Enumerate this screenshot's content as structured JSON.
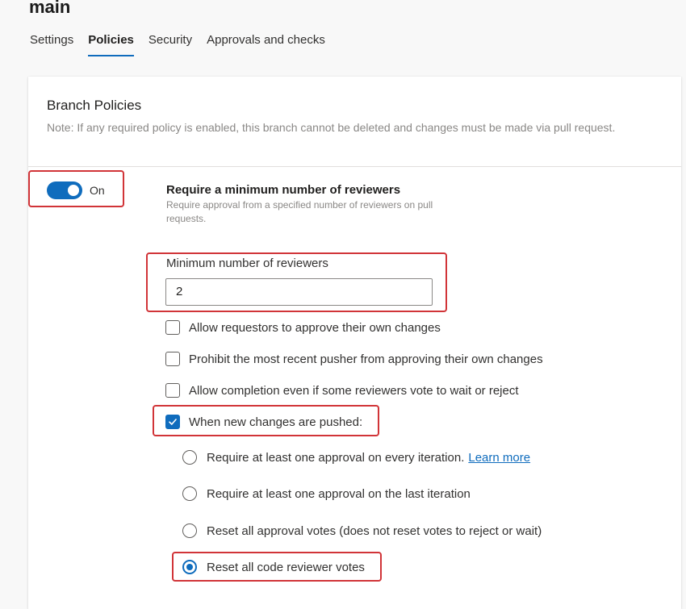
{
  "header": {
    "title": "main"
  },
  "tabs": [
    {
      "label": "Settings",
      "active": false
    },
    {
      "label": "Policies",
      "active": true
    },
    {
      "label": "Security",
      "active": false
    },
    {
      "label": "Approvals and checks",
      "active": false
    }
  ],
  "card": {
    "title": "Branch Policies",
    "note": "Note: If any required policy is enabled, this branch cannot be deleted and changes must be made via pull request."
  },
  "policy": {
    "toggle_label": "On",
    "toggle_on": true,
    "title": "Require a minimum number of reviewers",
    "description": "Require approval from a specified number of reviewers on pull requests.",
    "min_reviewers_label": "Minimum number of reviewers",
    "min_reviewers_value": "2",
    "options": [
      {
        "label": "Allow requestors to approve their own changes",
        "checked": false
      },
      {
        "label": "Prohibit the most recent pusher from approving their own changes",
        "checked": false
      },
      {
        "label": "Allow completion even if some reviewers vote to wait or reject",
        "checked": false
      },
      {
        "label": "When new changes are pushed:",
        "checked": true
      }
    ],
    "push_options": [
      {
        "label": "Require at least one approval on every iteration.",
        "link": "Learn more",
        "selected": false
      },
      {
        "label": "Require at least one approval on the last iteration",
        "selected": false
      },
      {
        "label": "Reset all approval votes (does not reset votes to reject or wait)",
        "selected": false
      },
      {
        "label": "Reset all code reviewer votes",
        "selected": true
      }
    ]
  },
  "colors": {
    "accent": "#0f6cbd",
    "highlight": "#d13438",
    "muted_text": "#8a8886"
  }
}
